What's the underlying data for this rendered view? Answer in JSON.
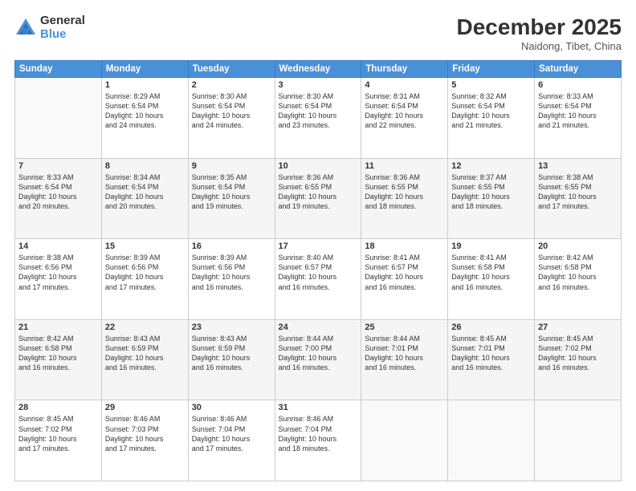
{
  "logo": {
    "general": "General",
    "blue": "Blue"
  },
  "header": {
    "month": "December 2025",
    "location": "Naidong, Tibet, China"
  },
  "weekdays": [
    "Sunday",
    "Monday",
    "Tuesday",
    "Wednesday",
    "Thursday",
    "Friday",
    "Saturday"
  ],
  "weeks": [
    [
      {
        "day": "",
        "info": ""
      },
      {
        "day": "1",
        "info": "Sunrise: 8:29 AM\nSunset: 6:54 PM\nDaylight: 10 hours\nand 24 minutes."
      },
      {
        "day": "2",
        "info": "Sunrise: 8:30 AM\nSunset: 6:54 PM\nDaylight: 10 hours\nand 24 minutes."
      },
      {
        "day": "3",
        "info": "Sunrise: 8:30 AM\nSunset: 6:54 PM\nDaylight: 10 hours\nand 23 minutes."
      },
      {
        "day": "4",
        "info": "Sunrise: 8:31 AM\nSunset: 6:54 PM\nDaylight: 10 hours\nand 22 minutes."
      },
      {
        "day": "5",
        "info": "Sunrise: 8:32 AM\nSunset: 6:54 PM\nDaylight: 10 hours\nand 21 minutes."
      },
      {
        "day": "6",
        "info": "Sunrise: 8:33 AM\nSunset: 6:54 PM\nDaylight: 10 hours\nand 21 minutes."
      }
    ],
    [
      {
        "day": "7",
        "info": "Sunrise: 8:33 AM\nSunset: 6:54 PM\nDaylight: 10 hours\nand 20 minutes."
      },
      {
        "day": "8",
        "info": "Sunrise: 8:34 AM\nSunset: 6:54 PM\nDaylight: 10 hours\nand 20 minutes."
      },
      {
        "day": "9",
        "info": "Sunrise: 8:35 AM\nSunset: 6:54 PM\nDaylight: 10 hours\nand 19 minutes."
      },
      {
        "day": "10",
        "info": "Sunrise: 8:36 AM\nSunset: 6:55 PM\nDaylight: 10 hours\nand 19 minutes."
      },
      {
        "day": "11",
        "info": "Sunrise: 8:36 AM\nSunset: 6:55 PM\nDaylight: 10 hours\nand 18 minutes."
      },
      {
        "day": "12",
        "info": "Sunrise: 8:37 AM\nSunset: 6:55 PM\nDaylight: 10 hours\nand 18 minutes."
      },
      {
        "day": "13",
        "info": "Sunrise: 8:38 AM\nSunset: 6:55 PM\nDaylight: 10 hours\nand 17 minutes."
      }
    ],
    [
      {
        "day": "14",
        "info": "Sunrise: 8:38 AM\nSunset: 6:56 PM\nDaylight: 10 hours\nand 17 minutes."
      },
      {
        "day": "15",
        "info": "Sunrise: 8:39 AM\nSunset: 6:56 PM\nDaylight: 10 hours\nand 17 minutes."
      },
      {
        "day": "16",
        "info": "Sunrise: 8:39 AM\nSunset: 6:56 PM\nDaylight: 10 hours\nand 16 minutes."
      },
      {
        "day": "17",
        "info": "Sunrise: 8:40 AM\nSunset: 6:57 PM\nDaylight: 10 hours\nand 16 minutes."
      },
      {
        "day": "18",
        "info": "Sunrise: 8:41 AM\nSunset: 6:57 PM\nDaylight: 10 hours\nand 16 minutes."
      },
      {
        "day": "19",
        "info": "Sunrise: 8:41 AM\nSunset: 6:58 PM\nDaylight: 10 hours\nand 16 minutes."
      },
      {
        "day": "20",
        "info": "Sunrise: 8:42 AM\nSunset: 6:58 PM\nDaylight: 10 hours\nand 16 minutes."
      }
    ],
    [
      {
        "day": "21",
        "info": "Sunrise: 8:42 AM\nSunset: 6:58 PM\nDaylight: 10 hours\nand 16 minutes."
      },
      {
        "day": "22",
        "info": "Sunrise: 8:43 AM\nSunset: 6:59 PM\nDaylight: 10 hours\nand 16 minutes."
      },
      {
        "day": "23",
        "info": "Sunrise: 8:43 AM\nSunset: 6:59 PM\nDaylight: 10 hours\nand 16 minutes."
      },
      {
        "day": "24",
        "info": "Sunrise: 8:44 AM\nSunset: 7:00 PM\nDaylight: 10 hours\nand 16 minutes."
      },
      {
        "day": "25",
        "info": "Sunrise: 8:44 AM\nSunset: 7:01 PM\nDaylight: 10 hours\nand 16 minutes."
      },
      {
        "day": "26",
        "info": "Sunrise: 8:45 AM\nSunset: 7:01 PM\nDaylight: 10 hours\nand 16 minutes."
      },
      {
        "day": "27",
        "info": "Sunrise: 8:45 AM\nSunset: 7:02 PM\nDaylight: 10 hours\nand 16 minutes."
      }
    ],
    [
      {
        "day": "28",
        "info": "Sunrise: 8:45 AM\nSunset: 7:02 PM\nDaylight: 10 hours\nand 17 minutes."
      },
      {
        "day": "29",
        "info": "Sunrise: 8:46 AM\nSunset: 7:03 PM\nDaylight: 10 hours\nand 17 minutes."
      },
      {
        "day": "30",
        "info": "Sunrise: 8:46 AM\nSunset: 7:04 PM\nDaylight: 10 hours\nand 17 minutes."
      },
      {
        "day": "31",
        "info": "Sunrise: 8:46 AM\nSunset: 7:04 PM\nDaylight: 10 hours\nand 18 minutes."
      },
      {
        "day": "",
        "info": ""
      },
      {
        "day": "",
        "info": ""
      },
      {
        "day": "",
        "info": ""
      }
    ]
  ]
}
